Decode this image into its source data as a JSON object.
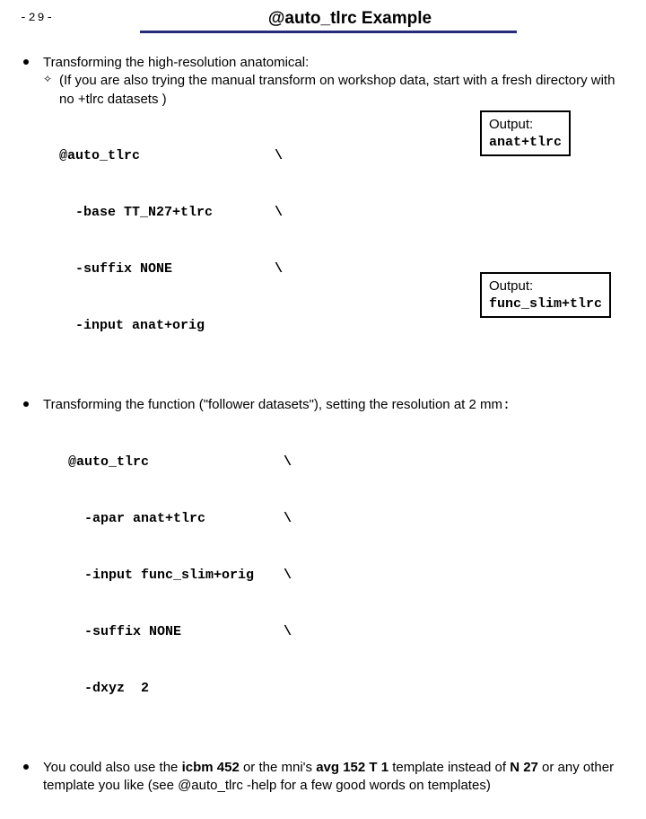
{
  "page_number": "-29-",
  "title": "@auto_tlrc Example",
  "bullets": {
    "b1": {
      "text": "Transforming the high-resolution anatomical:",
      "note": "(If you are also trying the manual transform on workshop data, start with a fresh directory with no +tlrc datasets )",
      "code": {
        "l1a": "@auto_tlrc",
        "l1b": "\\",
        "l2a": "  -base TT_N27+tlrc",
        "l2b": "\\",
        "l3a": "  -suffix NONE",
        "l3b": "\\",
        "l4a": "  -input anat+orig",
        "l4b": ""
      },
      "output_label": "Output:",
      "output_value": "anat+tlrc"
    },
    "b2": {
      "text_a": "Transforming the function (\"follower datasets\"), setting the resolution at 2 mm",
      "text_b": ":",
      "code": {
        "l1a": "@auto_tlrc",
        "l1b": "\\",
        "l2a": "  -apar anat+tlrc",
        "l2b": "\\",
        "l3a": "  -input func_slim+orig",
        "l3b": "\\",
        "l4a": "  -suffix NONE",
        "l4b": "\\",
        "l5a": "  -dxyz  2",
        "l5b": ""
      },
      "output_label": "Output:",
      "output_value": "func_slim+tlrc"
    },
    "b3": {
      "t1": "You could also use the ",
      "t2": "icbm 452",
      "t3": " or the mni's ",
      "t4": "avg 152 T 1",
      "t5": " template instead of ",
      "t6": "N 27",
      "t7": " or any other template you like (see @auto_tlrc -help for a few good words on templates)"
    }
  }
}
